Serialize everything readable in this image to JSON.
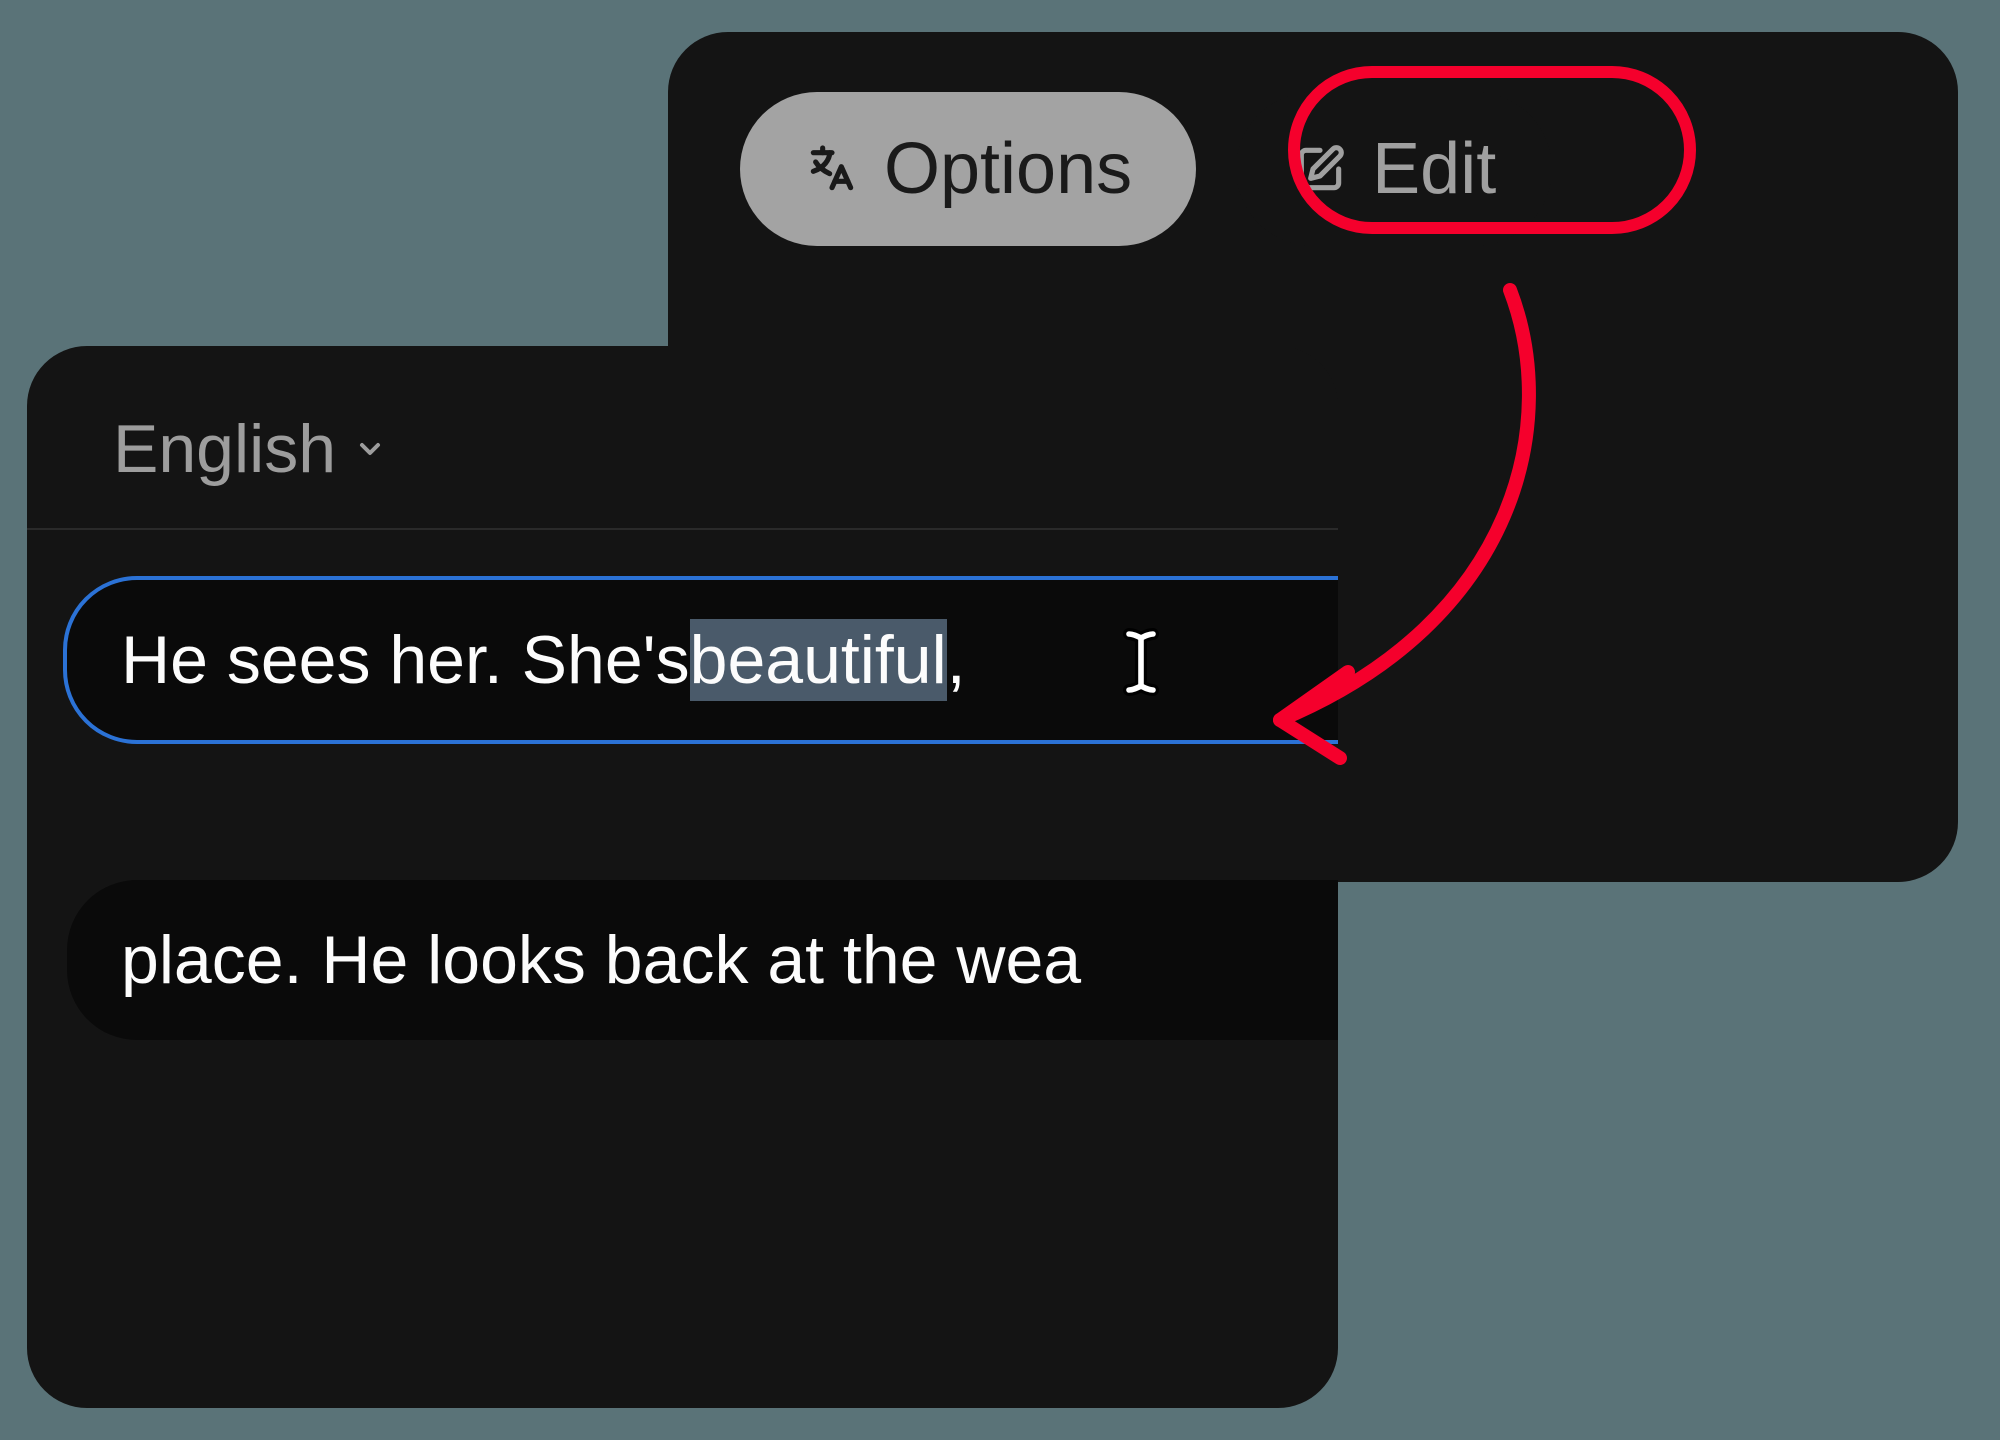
{
  "toolbar": {
    "options_label": "Options",
    "edit_label": "Edit"
  },
  "subtitle_panel": {
    "language": "English",
    "lines": [
      {
        "prefix": "He sees her. She's ",
        "highlighted": "beautiful",
        "suffix": ","
      },
      {
        "text": "place. He looks back at the wea"
      }
    ]
  },
  "colors": {
    "annotation": "#f5002c",
    "focus_outline": "#2b72d6",
    "panel_bg": "#141414",
    "button_bg": "#a3a3a3"
  }
}
